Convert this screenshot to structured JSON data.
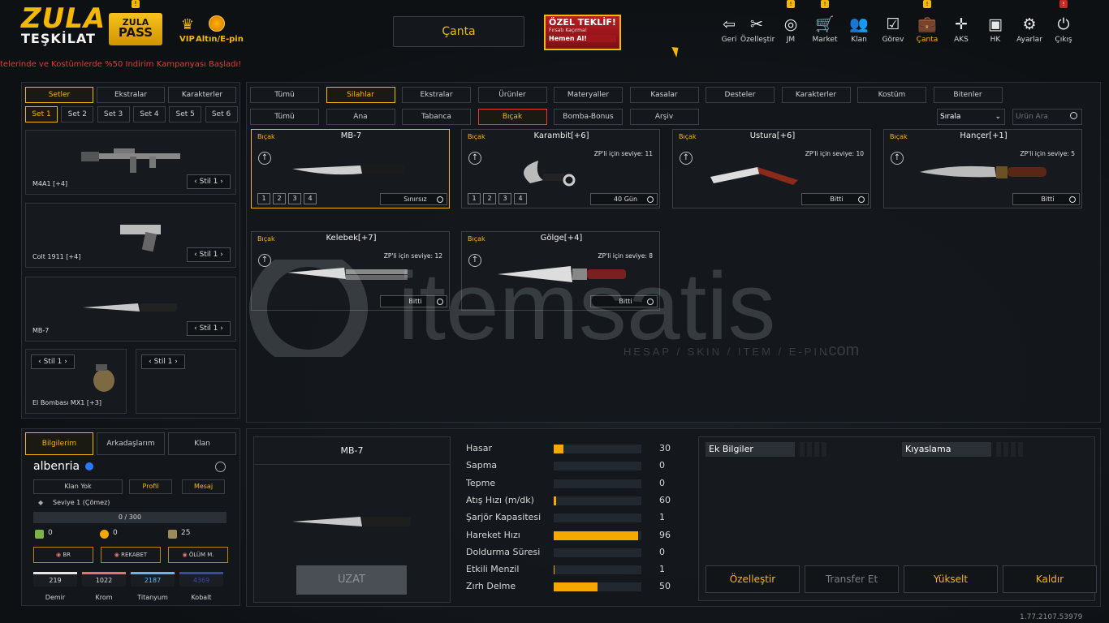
{
  "colors": {
    "accent": "#f5b800",
    "danger": "#e53935",
    "bg": "#0e1114"
  },
  "topbar": {
    "logo_line1": "ZULA",
    "logo_line2": "TEŞKİLAT",
    "pass_line1": "ZULA",
    "pass_line2": "PASS",
    "pass_badge": "!",
    "vip_label": "VIP",
    "gold_label": "Altın/E-pin",
    "marquee": "telerinde ve Kostümlerde %50 İndirim Kampanyası Başladı!",
    "center_tab": "Çanta",
    "offer": {
      "title": "ÖZEL TEKLİF!",
      "sub": "Fırsatı Kaçırma!",
      "cta": "Hemen Al!"
    },
    "nav": [
      {
        "label": "Geri",
        "icon": "back-icon"
      },
      {
        "label": "Özelleştir",
        "icon": "tools-icon"
      },
      {
        "label": "JM",
        "icon": "coins-icon",
        "badge": "!"
      },
      {
        "label": "Market",
        "icon": "cart-icon",
        "badge": "!"
      },
      {
        "label": "Klan",
        "icon": "users-icon"
      },
      {
        "label": "Görev",
        "icon": "clipboard-icon"
      },
      {
        "label": "Çanta",
        "icon": "bag-icon",
        "badge": "!",
        "active": true
      },
      {
        "label": "AKS",
        "icon": "crosshair-icon"
      },
      {
        "label": "HK",
        "icon": "wallet-icon"
      },
      {
        "label": "Ayarlar",
        "icon": "gear-icon"
      },
      {
        "label": "Çıkış",
        "icon": "power-icon",
        "badge": "!"
      }
    ]
  },
  "left": {
    "tabs": [
      "Setler",
      "Ekstralar",
      "Karakterler"
    ],
    "sets": [
      "Set 1",
      "Set 2",
      "Set 3",
      "Set 4",
      "Set 5",
      "Set 6"
    ],
    "slots": [
      {
        "name": "M4A1 [+4]",
        "stil": "Stil 1"
      },
      {
        "name": "Colt 1911 [+4]",
        "stil": "Stil 1"
      },
      {
        "name": "MB-7",
        "stil": "Stil 1"
      },
      {
        "name": "El Bombası MX1 [+3]",
        "stil": "Stil 1"
      },
      {
        "name": "",
        "stil": "Stil 1"
      }
    ]
  },
  "profile": {
    "tabs": [
      "Bilgilerim",
      "Arkadaşlarım",
      "Klan"
    ],
    "username": "albenria",
    "buttons": [
      "Klan Yok",
      "Profil",
      "Mesaj"
    ],
    "level": "Seviye 1 (Çömez)",
    "xp": "0 / 300",
    "xp_fraction": 0,
    "currencies": [
      "0",
      "0",
      "25"
    ],
    "modes": [
      "BR",
      "REKABET",
      "ÖLÜM M."
    ],
    "materials": [
      {
        "value": "219",
        "label": "Demir",
        "color": "#e6e6e6"
      },
      {
        "value": "1022",
        "label": "Krom",
        "color": "#e57373"
      },
      {
        "value": "2187",
        "label": "Titanyum",
        "color": "#64b5f6"
      },
      {
        "value": "4369",
        "label": "Kobalt",
        "color": "#3949ab"
      }
    ]
  },
  "filters": {
    "row1": [
      "Tümü",
      "Silahlar",
      "Ekstralar",
      "Ürünler",
      "Materyaller",
      "Kasalar",
      "Desteler",
      "Karakterler",
      "Kostüm",
      "Bitenler"
    ],
    "row1_selected": 1,
    "kasalar_badge": "!",
    "row2": [
      "Tümü",
      "Ana",
      "Tabanca",
      "Bıçak",
      "Bomba-Bonus",
      "Arşiv"
    ],
    "row2_selected": 3,
    "sort_label": "Sırala",
    "search_placeholder": "Ürün Ara"
  },
  "items": [
    {
      "cat": "Bıçak",
      "name": "MB-7",
      "zp": "",
      "levels": [
        "1",
        "2",
        "3",
        "4"
      ],
      "duration": "Sınırsız",
      "selected": true
    },
    {
      "cat": "Bıçak",
      "name": "Karambit[+6]",
      "zp": "ZP'li için seviye: 11",
      "levels": [
        "1",
        "2",
        "3",
        "4"
      ],
      "duration": "40 Gün"
    },
    {
      "cat": "Bıçak",
      "name": "Ustura[+6]",
      "zp": "ZP'li için seviye: 10",
      "levels": [],
      "duration": "Bitti"
    },
    {
      "cat": "Bıçak",
      "name": "Hançer[+1]",
      "zp": "ZP'li için seviye: 5",
      "levels": [],
      "duration": "Bitti"
    },
    {
      "cat": "Bıçak",
      "name": "Kelebek[+7]",
      "zp": "ZP'li için seviye: 12",
      "levels": [],
      "duration": "Bitti"
    },
    {
      "cat": "Bıçak",
      "name": "Gölge[+4]",
      "zp": "ZP'li için seviye: 8",
      "levels": [],
      "duration": "Bitti"
    }
  ],
  "detail": {
    "name": "MB-7",
    "extend_button": "UZAT",
    "stats": [
      {
        "label": "Hasar",
        "value": "30",
        "fraction": 0.11
      },
      {
        "label": "Sapma",
        "value": "0",
        "fraction": 0
      },
      {
        "label": "Tepme",
        "value": "0",
        "fraction": 0
      },
      {
        "label": "Atış Hızı (m/dk)",
        "value": "60",
        "fraction": 0.03
      },
      {
        "label": "Şarjör Kapasitesi",
        "value": "1",
        "fraction": 0
      },
      {
        "label": "Hareket Hızı",
        "value": "96",
        "fraction": 0.96
      },
      {
        "label": "Doldurma Süresi",
        "value": "0",
        "fraction": 0
      },
      {
        "label": "Etkili Menzil",
        "value": "1",
        "fraction": 0.01
      },
      {
        "label": "Zırh Delme",
        "value": "50",
        "fraction": 0.5
      }
    ],
    "extra_tab": "Ek Bilgiler",
    "compare_tab": "Kıyaslama",
    "actions": [
      {
        "label": "Özelleştir",
        "disabled": false
      },
      {
        "label": "Transfer Et",
        "disabled": true
      },
      {
        "label": "Yükselt",
        "disabled": false
      },
      {
        "label": "Kaldır",
        "disabled": false
      }
    ]
  },
  "watermark": {
    "brand": "itemsatis",
    "tagline": "HESAP / SKIN / ITEM / E-PIN",
    "domain": ".com"
  },
  "version": "1.77.2107.53979"
}
